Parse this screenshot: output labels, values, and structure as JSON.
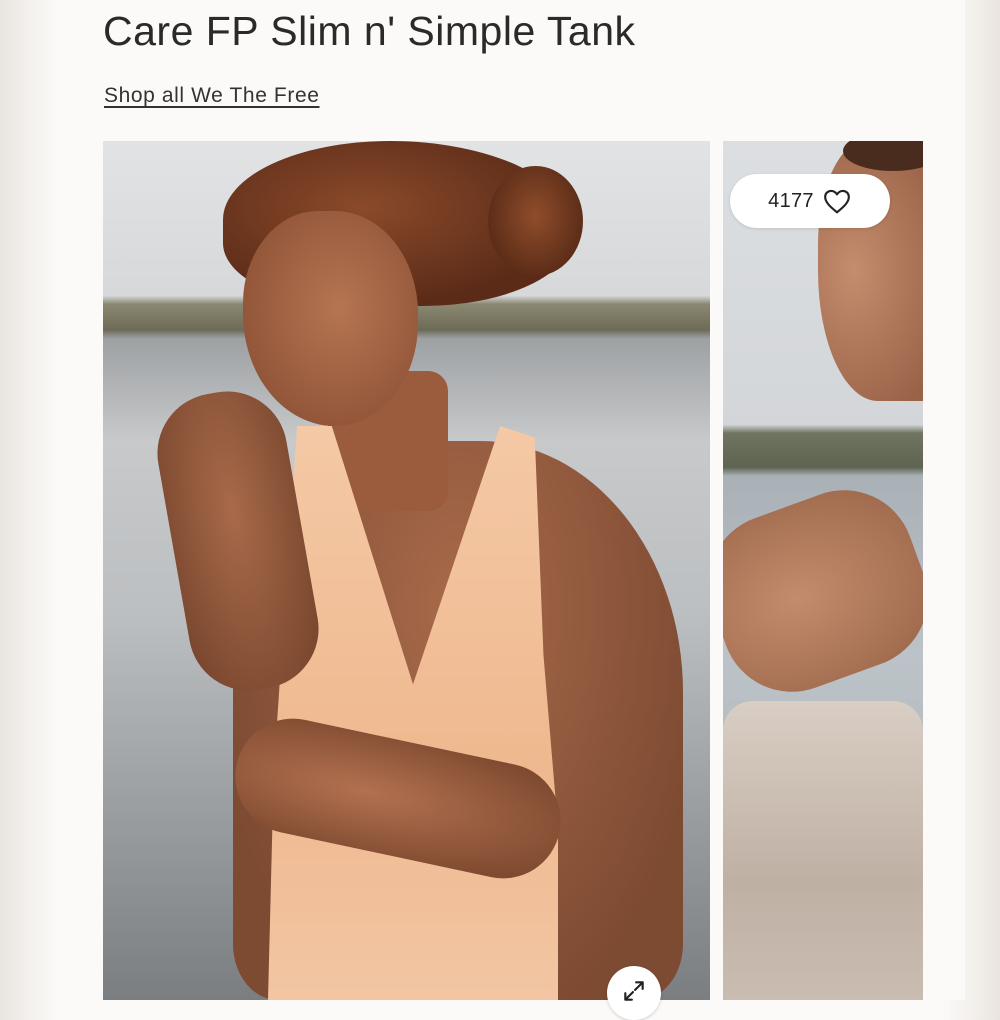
{
  "product": {
    "title": "Care FP Slim n' Simple Tank",
    "shop_link": "Shop all We The Free"
  },
  "gallery": {
    "images": [
      {
        "alt": "Model in peach tank by the water",
        "name": "main-photo"
      },
      {
        "alt": "Model smiling seated by the water",
        "name": "side-photo"
      }
    ],
    "like_count": "4177",
    "icons": {
      "like": "heart-icon",
      "expand": "expand-icon"
    }
  },
  "colors": {
    "text": "#2a2a2a",
    "pill_bg": "#ffffff",
    "page_bg": "#fbfaf8"
  }
}
